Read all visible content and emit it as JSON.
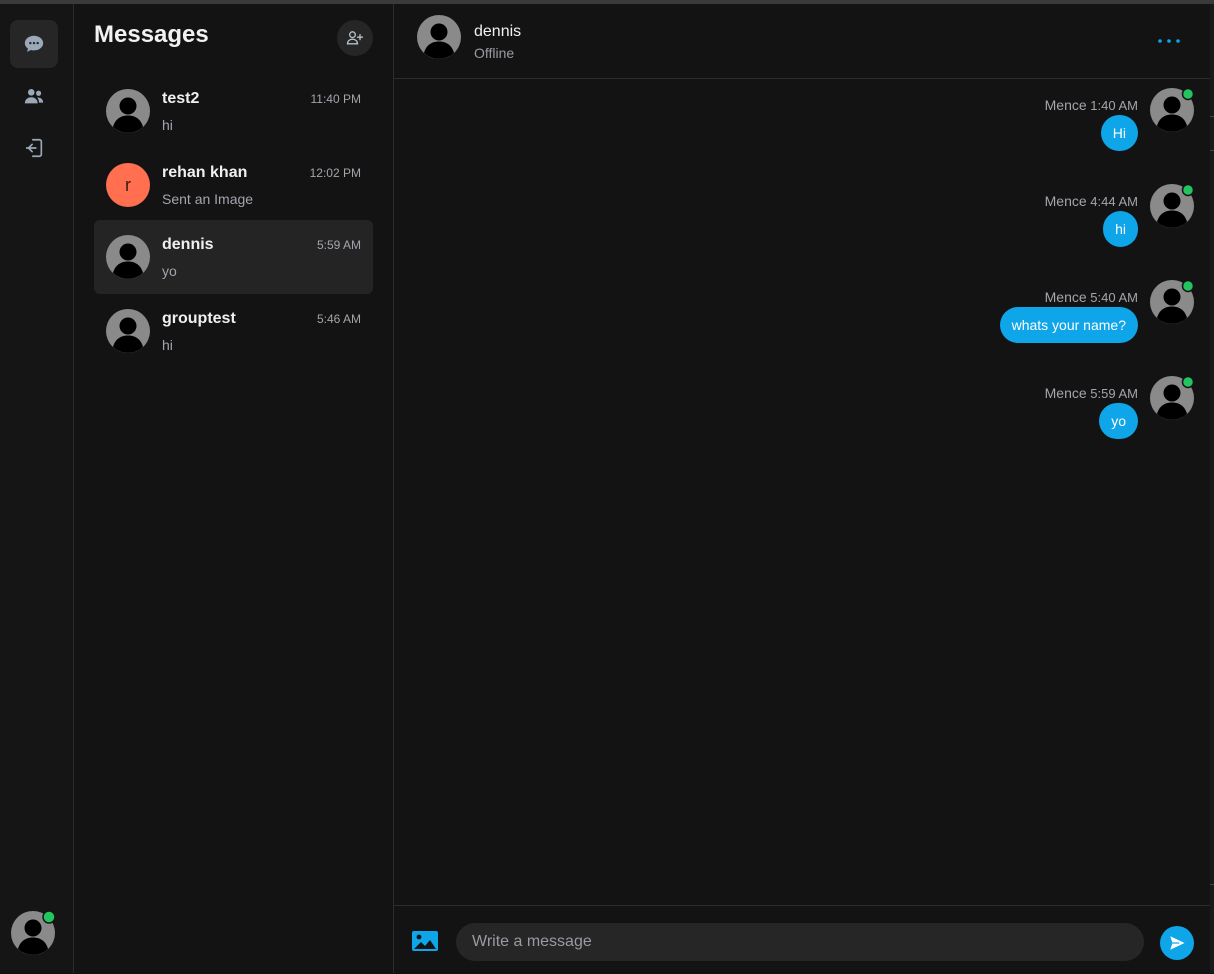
{
  "colors": {
    "accent": "#0ea5e9",
    "online": "#22c55e",
    "letter_avatar": "#ff6f50"
  },
  "rail": {
    "items": [
      {
        "icon": "chat-bubble-icon",
        "active": true
      },
      {
        "icon": "users-icon",
        "active": false
      },
      {
        "icon": "logout-icon",
        "active": false
      }
    ],
    "user_online": true
  },
  "sidebar": {
    "title": "Messages",
    "add_icon": "add-user-icon",
    "conversations": [
      {
        "name": "test2",
        "time": "11:40 PM",
        "preview": "hi",
        "avatar": "default"
      },
      {
        "name": "rehan khan",
        "time": "12:02 PM",
        "preview": "Sent an Image",
        "avatar": "letter",
        "letter": "r"
      },
      {
        "name": "dennis",
        "time": "5:59 AM",
        "preview": "yo",
        "avatar": "default",
        "active": true
      },
      {
        "name": "grouptest",
        "time": "5:46 AM",
        "preview": "hi",
        "avatar": "default"
      }
    ]
  },
  "chat": {
    "header": {
      "name": "dennis",
      "status": "Offline"
    },
    "messages": [
      {
        "author": "Mence",
        "time": "1:40 AM",
        "text": "Hi"
      },
      {
        "author": "Mence",
        "time": "4:44 AM",
        "text": "hi"
      },
      {
        "author": "Mence",
        "time": "5:40 AM",
        "text": "whats your name?"
      },
      {
        "author": "Mence",
        "time": "5:59 AM",
        "text": "yo"
      }
    ],
    "composer": {
      "placeholder": "Write a message"
    }
  }
}
